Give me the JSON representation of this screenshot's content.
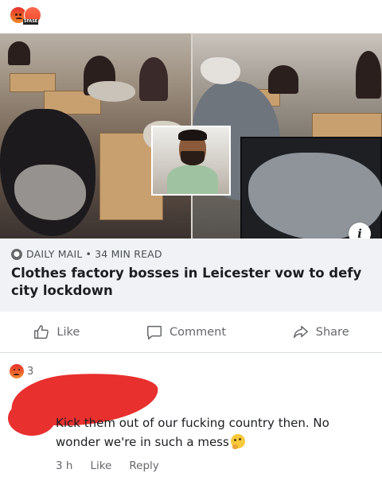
{
  "top_reactions": {
    "icons": [
      "angry-reaction-icon",
      "angry-reaction-icon"
    ]
  },
  "link_preview": {
    "source_name": "DAILY MAIL",
    "separator": "•",
    "time_ago": "34 MIN READ",
    "headline": "Clothes factory bosses in Leicester vow to defy city lockdown",
    "info_glyph": "i"
  },
  "actions": {
    "like_label": "Like",
    "comment_label": "Comment",
    "share_label": "Share"
  },
  "comment": {
    "reaction_count": "3",
    "text": "Kick them out of our fucking country then. No wonder we're in such a mess",
    "time": "3 h",
    "like_label": "Like",
    "reply_label": "Reply"
  },
  "colors": {
    "reaction_red": "#e8302e",
    "link_box_bg": "#f0f2f5",
    "muted_text": "#65676b"
  }
}
